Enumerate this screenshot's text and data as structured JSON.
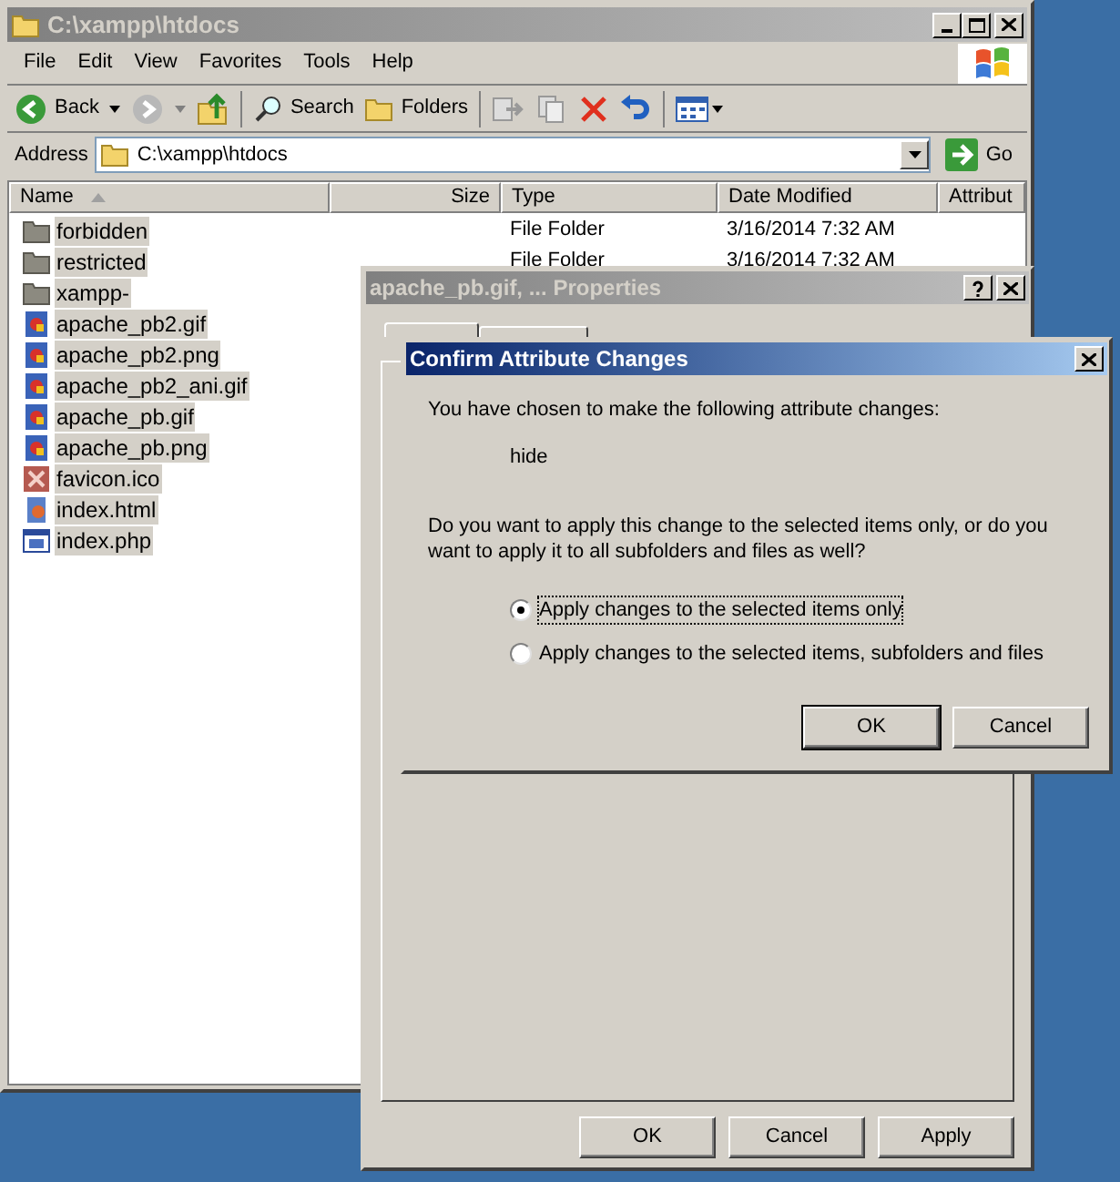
{
  "explorer": {
    "title": "C:\\xampp\\htdocs",
    "menu": [
      "File",
      "Edit",
      "View",
      "Favorites",
      "Tools",
      "Help"
    ],
    "toolbar": {
      "back": "Back",
      "search": "Search",
      "folders": "Folders"
    },
    "address": {
      "label": "Address",
      "value": "C:\\xampp\\htdocs",
      "go": "Go"
    },
    "columns": [
      "Name",
      "Size",
      "Type",
      "Date Modified",
      "Attribut"
    ],
    "files": [
      {
        "name": "forbidden",
        "kind": "folder",
        "type": "File Folder",
        "modified": "3/16/2014 7:32 AM",
        "selected": true
      },
      {
        "name": "restricted",
        "kind": "folder",
        "type": "File Folder",
        "modified": "3/16/2014 7:32 AM",
        "selected": true
      },
      {
        "name": "xampp-",
        "kind": "folder",
        "selected": true
      },
      {
        "name": "apache_pb2.gif",
        "kind": "image",
        "selected": true
      },
      {
        "name": "apache_pb2.png",
        "kind": "image",
        "selected": true
      },
      {
        "name": "apache_pb2_ani.gif",
        "kind": "image",
        "selected": true
      },
      {
        "name": "apache_pb.gif",
        "kind": "image",
        "selected": true
      },
      {
        "name": "apache_pb.png",
        "kind": "image",
        "selected": true
      },
      {
        "name": "favicon.ico",
        "kind": "ico",
        "selected": true
      },
      {
        "name": "index.html",
        "kind": "html",
        "selected": true
      },
      {
        "name": "index.php",
        "kind": "php",
        "selected": true
      }
    ]
  },
  "properties": {
    "title": "apache_pb.gif, ... Properties",
    "buttons": [
      "OK",
      "Cancel",
      "Apply"
    ]
  },
  "confirm": {
    "title": "Confirm Attribute Changes",
    "intro": "You have chosen to make the following attribute changes:",
    "change": "hide",
    "question": "Do you want to apply this change to the selected items only, or do you want to apply it to all subfolders and files as well?",
    "options": [
      {
        "label": "Apply changes to the selected items only",
        "selected": true
      },
      {
        "label": "Apply changes to the selected items, subfolders and files",
        "selected": false
      }
    ],
    "buttons": [
      "OK",
      "Cancel"
    ]
  }
}
